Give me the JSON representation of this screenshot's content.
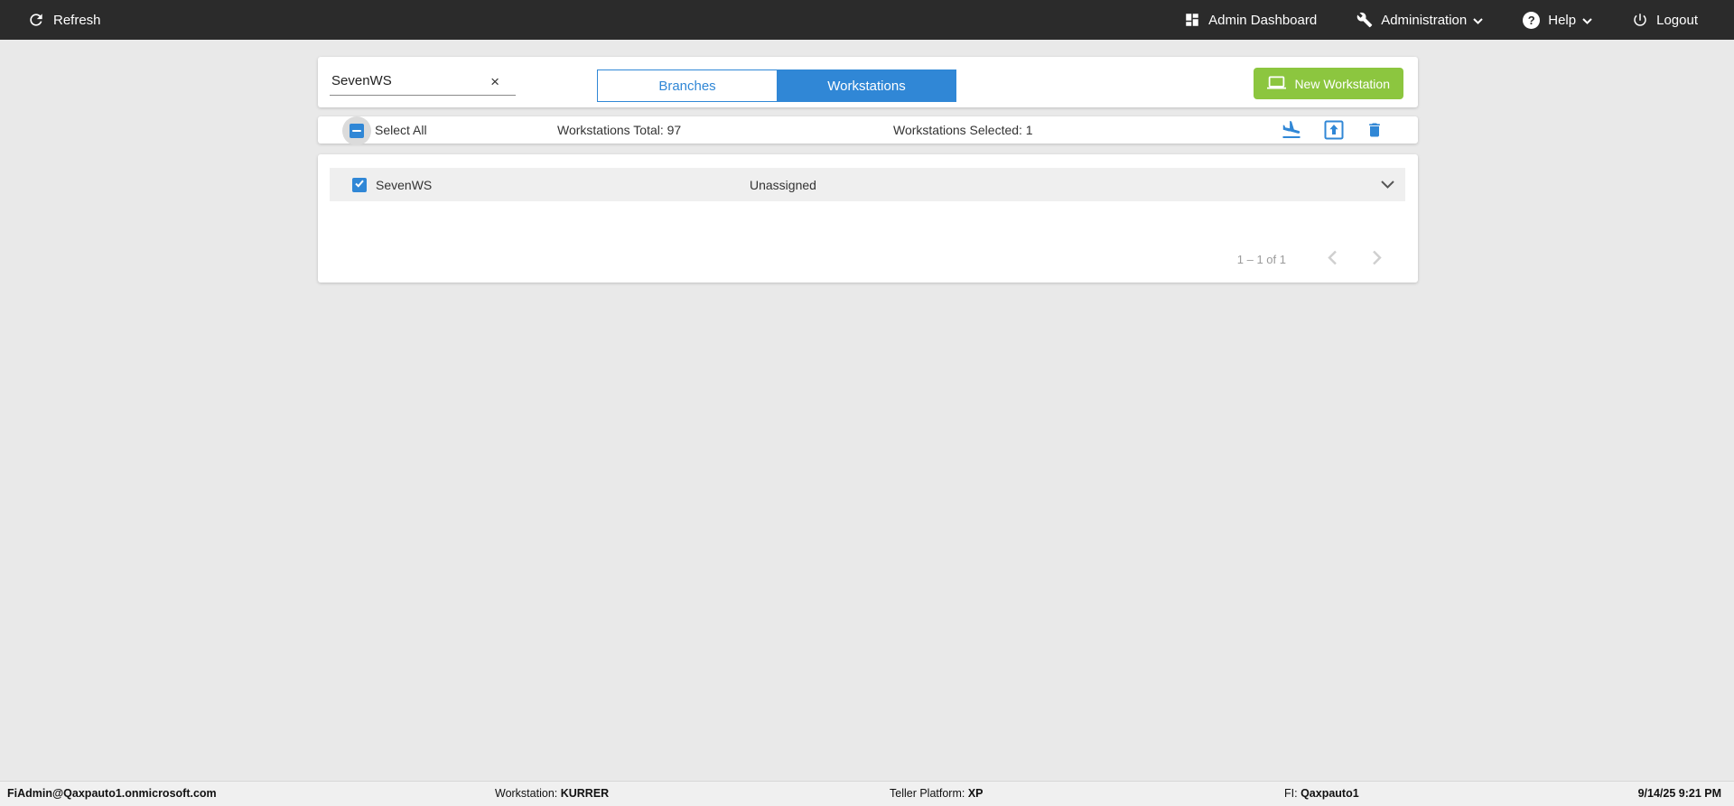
{
  "topbar": {
    "refresh_label": "Refresh",
    "admin_dashboard_label": "Admin Dashboard",
    "administration_label": "Administration",
    "help_label": "Help",
    "logout_label": "Logout"
  },
  "toolbar": {
    "search_value": "SevenWS",
    "branches_tab_label": "Branches",
    "workstations_tab_label": "Workstations",
    "new_workstation_label": "New Workstation"
  },
  "selection_bar": {
    "select_all_label": "Select All",
    "total_label": "Workstations Total: 97",
    "selected_label": "Workstations Selected: 1"
  },
  "list": {
    "rows": [
      {
        "name": "SevenWS",
        "status": "Unassigned",
        "selected": true
      }
    ],
    "pagination_label": "1 – 1 of 1"
  },
  "statusbar": {
    "user": "FiAdmin@Qaxpauto1.onmicrosoft.com",
    "workstation_label": "Workstation: ",
    "workstation_value": "KURRER",
    "platform_label": "Teller Platform: ",
    "platform_value": "XP",
    "fi_label": "FI: ",
    "fi_value": "Qaxpauto1",
    "datetime": "9/14/25 9:21 PM"
  },
  "icons": {
    "help_glyph": "?",
    "clear_glyph": "×"
  },
  "colors": {
    "accent_blue": "#3087d6",
    "accent_green": "#8cc63f",
    "topbar_bg": "#2b2b2b",
    "row_bg": "#efefef"
  }
}
